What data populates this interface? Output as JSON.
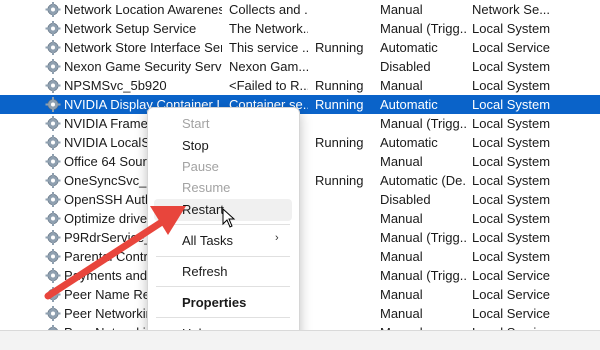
{
  "services": [
    {
      "name": "Network Location Awareness",
      "description": "Collects and ...",
      "status": "",
      "startup": "Manual",
      "logon": "Network Se..."
    },
    {
      "name": "Network Setup Service",
      "description": "The Network...",
      "status": "",
      "startup": "Manual (Trigg...",
      "logon": "Local System"
    },
    {
      "name": "Network Store Interface Servi...",
      "description": "This service ...",
      "status": "Running",
      "startup": "Automatic",
      "logon": "Local Service"
    },
    {
      "name": "Nexon Game Security Service",
      "description": "Nexon Gam...",
      "status": "",
      "startup": "Disabled",
      "logon": "Local System"
    },
    {
      "name": "NPSMSvc_5b920",
      "description": "<Failed to R...",
      "status": "Running",
      "startup": "Manual",
      "logon": "Local System"
    },
    {
      "name": "NVIDIA Display Container LS",
      "description": "Container se...",
      "status": "Running",
      "startup": "Automatic",
      "logon": "Local System",
      "selected": true
    },
    {
      "name": "NVIDIA FrameV",
      "description": "",
      "status": "",
      "startup": "Manual (Trigg...",
      "logon": "Local System"
    },
    {
      "name": "NVIDIA LocalSy",
      "description": "",
      "status": "Running",
      "startup": "Automatic",
      "logon": "Local System"
    },
    {
      "name": "Office 64 Sourc",
      "description": "",
      "status": "",
      "startup": "Manual",
      "logon": "Local System"
    },
    {
      "name": "OneSyncSvc_5b",
      "description": "",
      "status": "Running",
      "startup": "Automatic (De...",
      "logon": "Local System"
    },
    {
      "name": "OpenSSH Authe",
      "description": "",
      "status": "",
      "startup": "Disabled",
      "logon": "Local System"
    },
    {
      "name": "Optimize drive",
      "description": "",
      "status": "",
      "startup": "Manual",
      "logon": "Local System"
    },
    {
      "name": "P9RdrService_",
      "description": "",
      "status": "",
      "startup": "Manual (Trigg...",
      "logon": "Local System"
    },
    {
      "name": "Parental Contro",
      "description": "",
      "status": "",
      "startup": "Manual",
      "logon": "Local System"
    },
    {
      "name": "Payments and N",
      "description": "",
      "status": "",
      "startup": "Manual (Trigg...",
      "logon": "Local Service"
    },
    {
      "name": "Peer Name Reso",
      "description": "",
      "status": "",
      "startup": "Manual",
      "logon": "Local Service"
    },
    {
      "name": "Peer Networkin",
      "description": "",
      "status": "",
      "startup": "Manual",
      "logon": "Local Service"
    },
    {
      "name": "Peer Networkin",
      "description": "",
      "status": "",
      "startup": "Manual",
      "logon": "Local Service"
    }
  ],
  "context_menu": {
    "start": "Start",
    "stop": "Stop",
    "pause": "Pause",
    "resume": "Resume",
    "restart": "Restart",
    "all_tasks": "All Tasks",
    "refresh": "Refresh",
    "properties": "Properties",
    "help": "Help"
  },
  "colors": {
    "selection": "#0a63c9",
    "annotation_arrow": "#e8453c"
  },
  "icons": {
    "service": "gear-icon",
    "submenu": "chevron-right-icon",
    "pointer": "mouse-pointer-icon"
  }
}
